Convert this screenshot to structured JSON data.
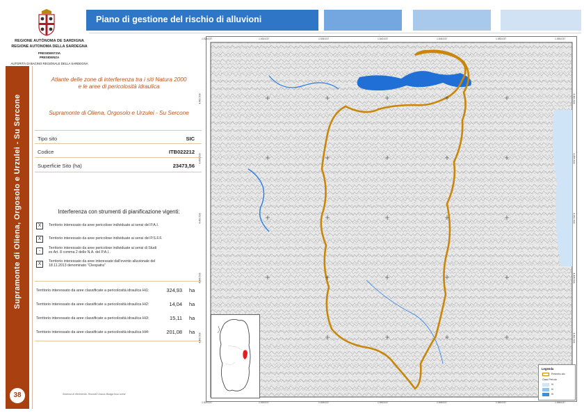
{
  "header": {
    "org_line1": "REGIONE AUTÒNOMA DE SARDIGNA",
    "org_line2": "REGIONE AUTONOMA DELLA SARDEGNA",
    "org_line3": "PRESIDENTZIA",
    "org_line4": "PRESIDENZA",
    "org_line5": "AUTORITÀ DI BACINO REGIONALE DELLA SARDEGNA",
    "title": "Piano di gestione del rischio di alluvioni"
  },
  "sidebar": {
    "site_label": "Supramonte di Oliena, Orgosolo e Urzulei - Su Sercone",
    "page_number": "38"
  },
  "info": {
    "atlas_title_1": "Atlante delle zone di interferenza tra i siti Natura 2000",
    "atlas_title_2": "e le aree di pericolosità idraulica",
    "site_name": "Supramonte di Oliena, Orgosolo e Urzulei - Su Sercone",
    "rows": [
      {
        "label": "Tipo sito",
        "value": "SIC"
      },
      {
        "label": "Codice",
        "value": "ITB022212"
      },
      {
        "label": "Superficie Sito (ha)",
        "value": "23473,56"
      }
    ],
    "interference_title": "Interferenza con strumenti di pianificazione vigenti:",
    "checks": [
      {
        "mark": "X",
        "line1": "Territorio interessato da aree pericolose individuate ai sensi del P.A.I.",
        "line2": ""
      },
      {
        "mark": "X",
        "line1": "Territorio interessato da aree pericolose individuate ai sensi del P.S.F.F.",
        "line2": ""
      },
      {
        "mark": "-",
        "line1": "Territorio interessato da aree pericolose individuate ai sensi di Studi",
        "line2": "ex Art. 8 comma 2 delle N.A. del P.A.I.."
      },
      {
        "mark": "X",
        "line1": "Territorio interessato da aree interessate dall'evento alluvionale del",
        "line2": "18.11.2013 denominato \"Cleopatra\""
      }
    ],
    "hazards": [
      {
        "label": "Territorio interessato da aree classificate a pericolosità idraulica Hi1:",
        "value": "324,93",
        "unit": "ha"
      },
      {
        "label": "Territorio interessato da aree classificate a pericolosità idraulica Hi2:",
        "value": "14,04",
        "unit": "ha"
      },
      {
        "label": "Territorio interessato da aree classificate a pericolosità idraulica Hi3:",
        "value": "15,11",
        "unit": "ha"
      },
      {
        "label": "Territorio interessato da aree classificate a pericolosità idraulica Hi4:",
        "value": "201,08",
        "unit": "ha"
      }
    ],
    "reference_note": "Sistema di riferimento: Roma40 Gauss Boaga fuso ovest"
  },
  "map": {
    "top_ticks": [
      "1.525.037",
      "1.530.037",
      "1.535.037",
      "1.540.037",
      "1.545.037",
      "1.550.037",
      "1.555.037"
    ],
    "bottom_ticks": [
      "1.525.037",
      "1.530.037",
      "1.535.037",
      "1.540.037",
      "1.545.037",
      "1.550.037",
      "1.555.037"
    ],
    "left_ticks": [
      "4.460.506",
      "4.455.506",
      "4.450.506",
      "4.445.506",
      "4.440.506"
    ],
    "right_ticks": [
      "4.460.506",
      "4.455.506",
      "4.450.506",
      "4.445.506",
      "4.440.506"
    ],
    "colors": {
      "boundary": "#c8860a",
      "water": "#2a7ee0",
      "lake": "#1f6fd6",
      "relief": "#cfcfcf"
    },
    "legend": {
      "title": "Legenda",
      "items": [
        {
          "label": "Perimetro sito",
          "color": "#c8860a"
        },
        {
          "label": "Classi Pericolo",
          "color": ""
        },
        {
          "label": "Hi",
          "color": "#cfe6fb"
        },
        {
          "label": "Hi",
          "color": "#8cc4f2"
        },
        {
          "label": "Hi",
          "color": "#3d8fd8"
        }
      ]
    }
  }
}
